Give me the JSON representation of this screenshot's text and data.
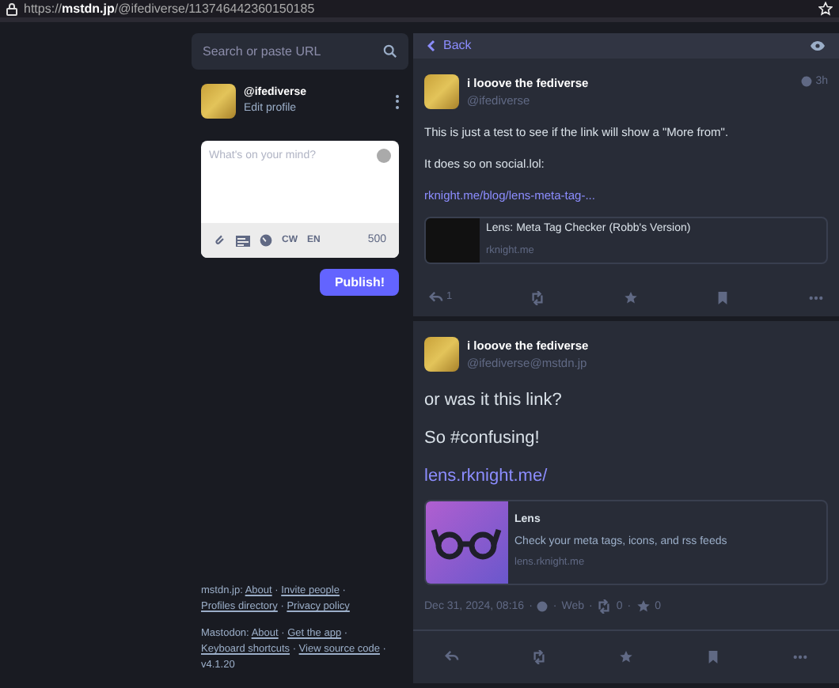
{
  "address_bar": {
    "scheme": "https://",
    "host": "mstdn.jp",
    "path": "/@ifediverse/113746442360150185"
  },
  "search": {
    "placeholder": "Search or paste URL"
  },
  "profile": {
    "handle": "@ifediverse",
    "edit_link": "Edit profile"
  },
  "compose": {
    "placeholder": "What's on your mind?",
    "cw": "CW",
    "language": "EN",
    "counter": "500",
    "publish": "Publish!"
  },
  "footer_separator": "·",
  "footer": [
    {
      "label": "mstdn.jp:",
      "links": [
        "About",
        "Invite people",
        "Profiles directory",
        "Privacy policy"
      ]
    },
    {
      "label": "Mastodon:",
      "links": [
        "About",
        "Get the app",
        "Keyboard shortcuts",
        "View source code"
      ],
      "version": "v4.1.20"
    }
  ],
  "column_header": {
    "back": "Back"
  },
  "posts": [
    {
      "kind": "reply",
      "name": "i looove the fediverse",
      "handle": "@ifediverse",
      "time": "3h",
      "paragraphs": [
        "This is just a test to see if the link will show a \"More from\".",
        "It does so on social.lol:"
      ],
      "link": "rknight.me/blog/lens-meta-tag-...",
      "card": {
        "title": "Lens: Meta Tag Checker (Robb's Version)",
        "domain": "rknight.me"
      },
      "reply_count": "1"
    },
    {
      "kind": "detailed",
      "name": "i looove the fediverse",
      "handle": "@ifediverse@mstdn.jp",
      "paragraphs": [
        "or was it this link?",
        "So #confusing!"
      ],
      "link": "lens.rknight.me/",
      "card": {
        "title": "Lens",
        "description": "Check your meta tags, icons, and rss feeds",
        "domain": "lens.rknight.me"
      },
      "meta": {
        "separator": "·",
        "date": "Dec 31, 2024, 08:16",
        "app": "Web",
        "boosts": "0",
        "favourites": "0"
      }
    }
  ]
}
